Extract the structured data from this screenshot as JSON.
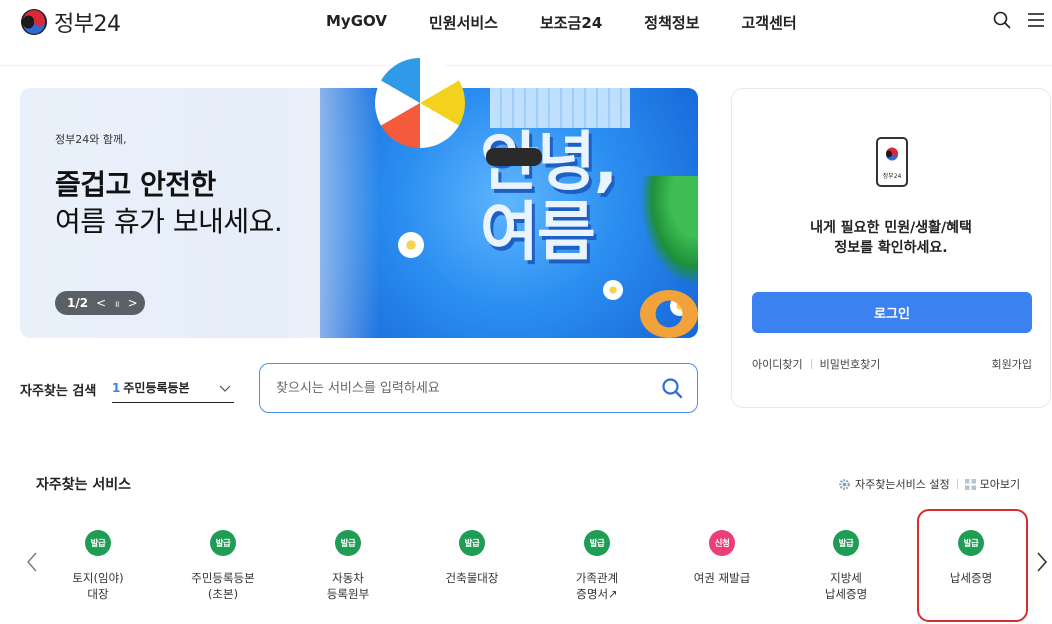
{
  "header": {
    "logo_text": "정부24",
    "nav": [
      "MyGOV",
      "민원서비스",
      "보조금24",
      "정책정보",
      "고객센터"
    ]
  },
  "banner": {
    "small": "정부24와 함께,",
    "line1": "즐겁고 안전한",
    "line2": "여름 휴가 보내세요.",
    "big_line1": "안녕,",
    "big_line2": "여름",
    "pager_index": "1/2",
    "pager_prev": "<",
    "pager_pause": "॥",
    "pager_next": ">"
  },
  "login": {
    "phone_label": "정부24",
    "message_line1": "내게 필요한 민원/생활/혜택",
    "message_line2": "정보를 확인하세요.",
    "button": "로그인",
    "find_id": "아이디찾기",
    "find_pw": "비밀번호찾기",
    "join": "회원가입"
  },
  "search": {
    "freq_label": "자주찾는 검색",
    "freq_num": "1",
    "freq_value": "주민등록등본",
    "placeholder": "찾으시는 서비스를 입력하세요"
  },
  "services": {
    "title": "자주찾는 서비스",
    "settings": "자주찾는서비스 설정",
    "view_all": "모아보기",
    "colors": {
      "issue": "#1f9d55",
      "apply": "#ec3f78"
    },
    "items": [
      {
        "badge": "발급",
        "name": "토지(임야)\n대장"
      },
      {
        "badge": "발급",
        "name": "주민등록등본\n(초본)"
      },
      {
        "badge": "발급",
        "name": "자동차\n등록원부"
      },
      {
        "badge": "발급",
        "name": "건축물대장"
      },
      {
        "badge": "발급",
        "name": "가족관계\n증명서↗"
      },
      {
        "badge": "신청",
        "name": "여권 재발급"
      },
      {
        "badge": "발급",
        "name": "지방세\n납세증명"
      },
      {
        "badge": "발급",
        "name": "납세증명"
      }
    ]
  }
}
